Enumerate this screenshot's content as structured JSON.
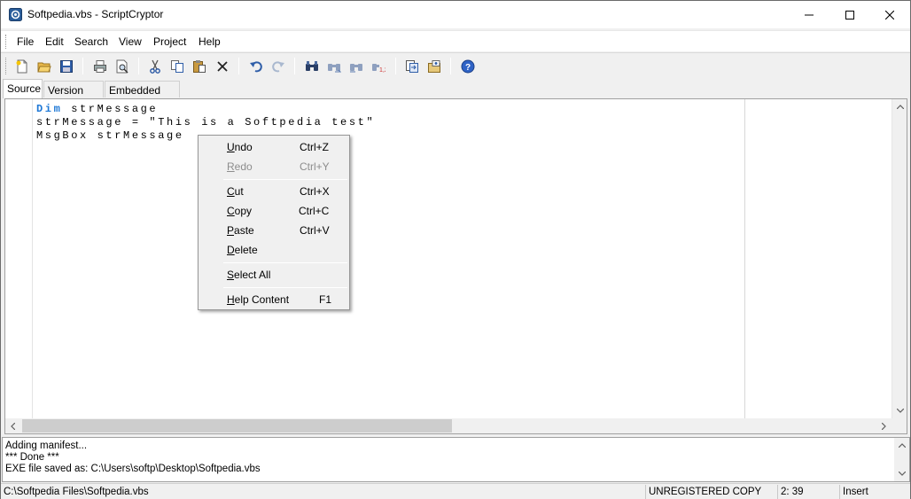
{
  "window": {
    "title": "Softpedia.vbs - ScriptCryptor"
  },
  "menubar": {
    "items": [
      {
        "label": "File"
      },
      {
        "label": "Edit"
      },
      {
        "label": "Search"
      },
      {
        "label": "View"
      },
      {
        "label": "Project"
      },
      {
        "label": "Help"
      }
    ]
  },
  "toolbar": {
    "buttons": [
      "new-file-icon",
      "open-folder-icon",
      "save-icon",
      "print-icon",
      "print-preview-icon",
      "cut-icon",
      "copy-icon",
      "paste-icon",
      "delete-icon",
      "undo-icon",
      "redo-icon",
      "find-icon",
      "find-next-icon",
      "replace-icon",
      "goto-line-icon",
      "compile-icon",
      "project-options-icon",
      "help-icon"
    ]
  },
  "tabs": [
    {
      "label": "Source",
      "active": true
    },
    {
      "label": "Version Info",
      "active": false
    },
    {
      "label": "Embedded Files",
      "active": false
    }
  ],
  "editor": {
    "line1_keyword": "Dim",
    "line1_rest": " strMessage",
    "line2": "strMessage = \"This is a Softpedia test\"",
    "line3": "MsgBox strMessage",
    "keyword_color": "#1e78d6"
  },
  "context_menu": {
    "items": [
      {
        "label": "Undo",
        "shortcut": "Ctrl+Z",
        "enabled": true
      },
      {
        "label": "Redo",
        "shortcut": "Ctrl+Y",
        "enabled": false
      },
      {
        "label": "Cut",
        "shortcut": "Ctrl+X",
        "enabled": true
      },
      {
        "label": "Copy",
        "shortcut": "Ctrl+C",
        "enabled": true
      },
      {
        "label": "Paste",
        "shortcut": "Ctrl+V",
        "enabled": true
      },
      {
        "label": "Delete",
        "shortcut": "",
        "enabled": true
      },
      {
        "label": "Select All",
        "shortcut": "",
        "enabled": true
      },
      {
        "label": "Help Content",
        "shortcut": "F1",
        "enabled": true
      }
    ]
  },
  "output": {
    "lines": [
      "Adding manifest...",
      "*** Done ***",
      "EXE file saved as: C:\\Users\\softp\\Desktop\\Softpedia.vbs"
    ]
  },
  "statusbar": {
    "path": "C:\\Softpedia Files\\Softpedia.vbs",
    "registration": "UNREGISTERED COPY",
    "cursor_position": "2: 39",
    "mode": "Insert"
  }
}
